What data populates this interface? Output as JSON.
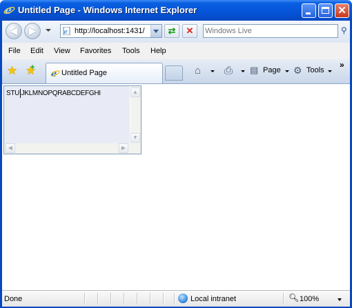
{
  "window": {
    "title": "Untitled Page - Windows Internet Explorer"
  },
  "address": {
    "url": "http://localhost:1431/"
  },
  "search": {
    "placeholder": "Windows Live"
  },
  "menu": {
    "items": [
      "File",
      "Edit",
      "View",
      "Favorites",
      "Tools",
      "Help"
    ]
  },
  "tab": {
    "label": "Untitled Page"
  },
  "toolbar": {
    "page_label": "Page",
    "tools_label": "Tools"
  },
  "textarea": {
    "value": "STUIJKLMNOPQRABCDEFGHI"
  },
  "status": {
    "text": "Done",
    "zone": "Local intranet",
    "zoom": "100%"
  },
  "colors": {
    "titlebar": "#0554d8",
    "close_button": "#c7391b",
    "content_bg": "#e8ebf5"
  }
}
